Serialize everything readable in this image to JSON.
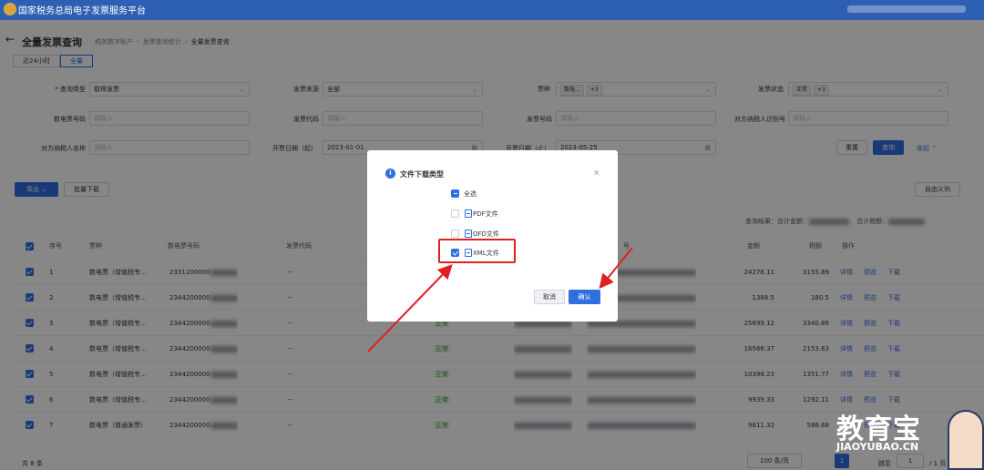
{
  "app": {
    "title": "国家税务总局电子发票服务平台"
  },
  "breadcrumb": {
    "page_title": "全量发票查询",
    "path": [
      "税务数字账户",
      "发票查询统计",
      "全量发票查询"
    ],
    "back": "←"
  },
  "tabs": [
    {
      "label": "近24小时",
      "active": false
    },
    {
      "label": "全量",
      "active": true
    }
  ],
  "filters": {
    "query_type_label": "* 查询类型",
    "query_type_value": "取得发票",
    "source_label": "发票来源",
    "source_value": "全部",
    "type_label": "票种",
    "type_chip": "数电...",
    "type_more": "+3",
    "status_label": "发票状态",
    "status_chip": "正常",
    "status_more": "+3",
    "elec_no_label": "数电票号码",
    "elec_no_ph": "请输入",
    "code_label": "发票代码",
    "code_ph": "请输入",
    "num_label": "发票号码",
    "num_ph": "请输入",
    "taxid_label": "对方纳税人识别号",
    "taxid_ph": "请输入",
    "name_label": "对方纳税人名称",
    "name_ph": "请输入",
    "date_from_label": "开票日期（起）",
    "date_from": "2023-01-01",
    "date_to_label": "开票日期（止）",
    "date_to": "2023-05-25",
    "reset": "重置",
    "search": "查询",
    "collapse": "收起"
  },
  "toolbar": {
    "export": "导出",
    "batch_download": "批量下载",
    "custom_columns": "自由义列",
    "result_label": "查询结果：",
    "total_amount_label": "合计金额：",
    "total_tax_label": "合计税额："
  },
  "table": {
    "headers": {
      "seq": "序号",
      "kind": "票种",
      "elec_no": "数电票号码",
      "code": "发票代码",
      "seller": "号",
      "amount": "金额",
      "tax": "税额",
      "ops": "操作"
    },
    "ops": {
      "detail": "详情",
      "preview": "预览",
      "download": "下载"
    },
    "rows": [
      {
        "seq": "1",
        "kind": "数电票（增值税专...",
        "no": "2331200000",
        "code": "--",
        "status": "",
        "amount": "24276.11",
        "tax": "3155.89"
      },
      {
        "seq": "2",
        "kind": "数电票（增值税专...",
        "no": "2344200000",
        "code": "--",
        "status": "",
        "amount": "1388.5",
        "tax": "180.5"
      },
      {
        "seq": "3",
        "kind": "数电票（增值税专...",
        "no": "2344200000",
        "code": "--",
        "status": "正常",
        "amount": "25699.12",
        "tax": "3340.88"
      },
      {
        "seq": "4",
        "kind": "数电票（增值税专...",
        "no": "2344200000",
        "code": "--",
        "status": "正常",
        "amount": "16566.37",
        "tax": "2153.63"
      },
      {
        "seq": "5",
        "kind": "数电票（增值税专...",
        "no": "2344200000",
        "code": "--",
        "status": "正常",
        "amount": "10398.23",
        "tax": "1351.77"
      },
      {
        "seq": "6",
        "kind": "数电票（增值税专...",
        "no": "2344200000",
        "code": "--",
        "status": "正常",
        "amount": "9939.33",
        "tax": "1292.11"
      },
      {
        "seq": "7",
        "kind": "数电票（普通发票）",
        "no": "2344200000",
        "code": "--",
        "status": "正常",
        "amount": "9811.32",
        "tax": "588.68"
      }
    ]
  },
  "pagination": {
    "total": "共 8 条",
    "page_size": "100 条/页",
    "page": "1",
    "jump_label": "跳至",
    "jump_value": "1",
    "pages": "/ 1 页"
  },
  "modal": {
    "title": "文件下载类型",
    "options": [
      {
        "label": "全选",
        "state": "indeterminate"
      },
      {
        "label": "PDF文件",
        "state": "unchecked"
      },
      {
        "label": "OFD文件",
        "state": "unchecked"
      },
      {
        "label": "XML文件",
        "state": "checked"
      }
    ],
    "cancel": "取消",
    "confirm": "确认",
    "close": "×"
  },
  "watermark": {
    "big": "教育宝",
    "small": "JIAOYUBAO.CN"
  },
  "colors": {
    "brand": "#2d5fb2",
    "primary": "#2f6fe0",
    "highlight": "#e02020"
  }
}
